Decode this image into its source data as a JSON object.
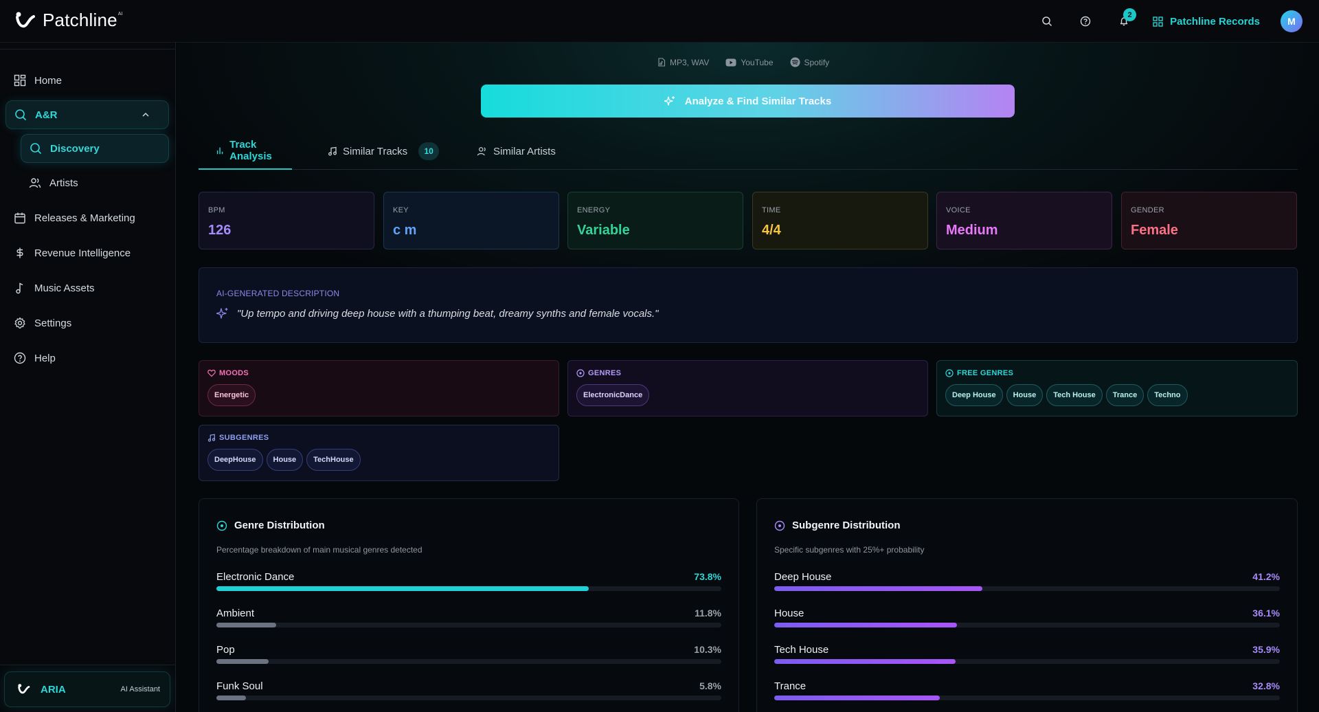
{
  "app": {
    "brand": "Patchline",
    "brand_sup": "AI",
    "notifications": "2",
    "org_name": "Patchline Records",
    "avatar": "M"
  },
  "sidebar": {
    "items": [
      {
        "label": "Home",
        "icon": "grid-icon"
      },
      {
        "label": "A&R",
        "icon": "search-icon",
        "expanded": true
      },
      {
        "label": "Discovery",
        "icon": "search-icon",
        "active": true
      },
      {
        "label": "Artists",
        "icon": "users-icon"
      },
      {
        "label": "Releases & Marketing",
        "icon": "calendar-icon"
      },
      {
        "label": "Revenue Intelligence",
        "icon": "dollar-icon"
      },
      {
        "label": "Music Assets",
        "icon": "music-note-icon"
      },
      {
        "label": "Settings",
        "icon": "gear-icon"
      },
      {
        "label": "Help",
        "icon": "help-icon"
      }
    ],
    "aria": {
      "name": "ARIA",
      "subtitle": "AI Assistant"
    }
  },
  "sources": [
    "MP3, WAV",
    "YouTube",
    "Spotify"
  ],
  "analyze_button": "Analyze & Find Similar Tracks",
  "tabs": [
    {
      "label": "Track Analysis",
      "active": true
    },
    {
      "label": "Similar Tracks",
      "count": "10"
    },
    {
      "label": "Similar Artists"
    }
  ],
  "stats": [
    {
      "label": "BPM",
      "value": "126",
      "color": "#a78bfa"
    },
    {
      "label": "KEY",
      "value": "c m",
      "color": "#60a5fa"
    },
    {
      "label": "ENERGY",
      "value": "Variable",
      "color": "#34d399"
    },
    {
      "label": "TIME",
      "value": "4/4",
      "color": "#f5c542"
    },
    {
      "label": "VOICE",
      "value": "Medium",
      "color": "#e879f9"
    },
    {
      "label": "GENDER",
      "value": "Female",
      "color": "#fb7185"
    }
  ],
  "description": {
    "label": "AI-GENERATED DESCRIPTION",
    "text": "\"Up tempo and driving deep house with a thumping beat, dreamy synths and female vocals.\""
  },
  "tag_groups": {
    "moods": {
      "label": "MOODS",
      "tags": [
        "Energetic"
      ]
    },
    "genres": {
      "label": "GENRES",
      "tags": [
        "ElectronicDance"
      ]
    },
    "free_genres": {
      "label": "FREE GENRES",
      "tags": [
        "Deep House",
        "House",
        "Tech House",
        "Trance",
        "Techno"
      ]
    },
    "subgenres": {
      "label": "SUBGENRES",
      "tags": [
        "DeepHouse",
        "House",
        "TechHouse"
      ]
    }
  },
  "genre_distribution": {
    "title": "Genre Distribution",
    "subtitle": "Percentage breakdown of main musical genres detected",
    "rows": [
      {
        "label": "Electronic Dance",
        "pct_text": "73.8%",
        "value": 73.8
      },
      {
        "label": "Ambient",
        "pct_text": "11.8%",
        "value": 11.8
      },
      {
        "label": "Pop",
        "pct_text": "10.3%",
        "value": 10.3
      },
      {
        "label": "Funk Soul",
        "pct_text": "5.8%",
        "value": 5.8
      }
    ]
  },
  "subgenre_distribution": {
    "title": "Subgenre Distribution",
    "subtitle": "Specific subgenres with 25%+ probability",
    "rows": [
      {
        "label": "Deep House",
        "pct_text": "41.2%",
        "value": 41.2
      },
      {
        "label": "House",
        "pct_text": "36.1%",
        "value": 36.1
      },
      {
        "label": "Tech House",
        "pct_text": "35.9%",
        "value": 35.9
      },
      {
        "label": "Trance",
        "pct_text": "32.8%",
        "value": 32.8
      }
    ]
  },
  "colors": {
    "accent": "#22d3d3",
    "purple": "#a78bfa"
  }
}
